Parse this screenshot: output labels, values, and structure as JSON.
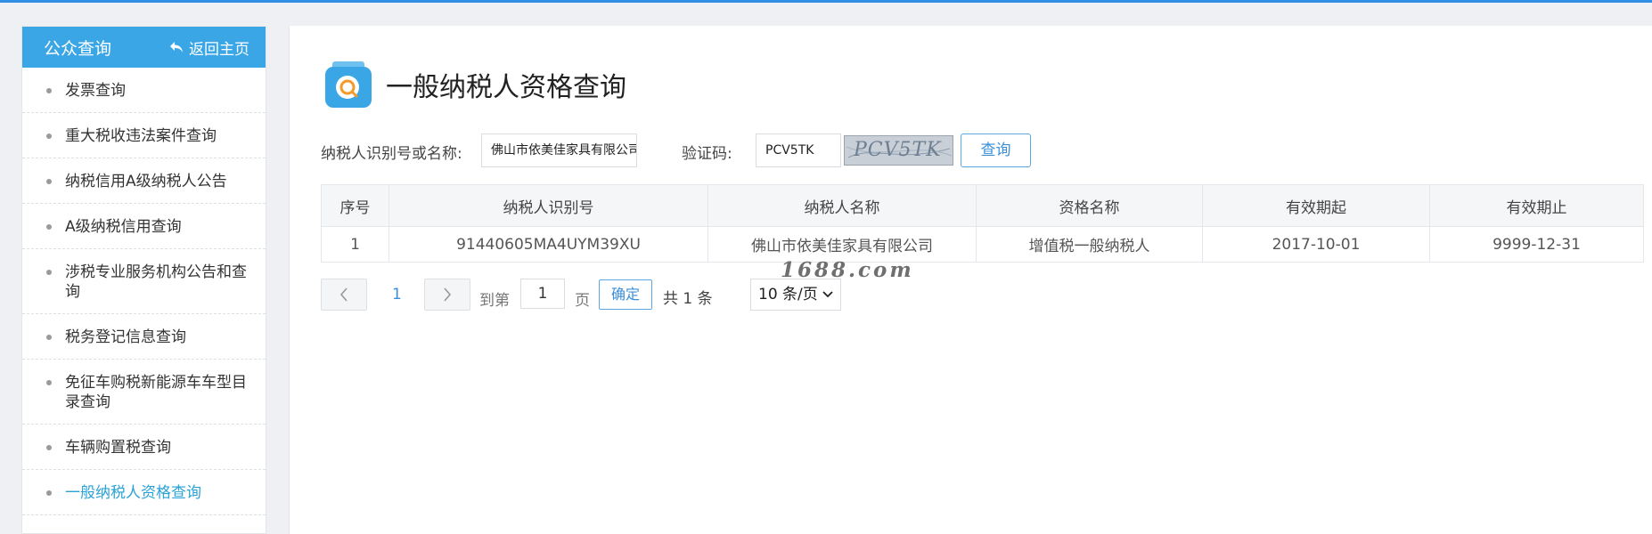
{
  "sidebar": {
    "title": "公众查询",
    "back_label": "返回主页",
    "items": [
      {
        "label": "发票查询"
      },
      {
        "label": "重大税收违法案件查询"
      },
      {
        "label": "纳税信用A级纳税人公告"
      },
      {
        "label": "A级纳税信用查询"
      },
      {
        "label": "涉税专业服务机构公告和查询"
      },
      {
        "label": "税务登记信息查询"
      },
      {
        "label": "免征车购税新能源车车型目录查询"
      },
      {
        "label": "车辆购置税查询"
      },
      {
        "label": "一般纳税人资格查询"
      }
    ]
  },
  "page": {
    "title": "一般纳税人资格查询"
  },
  "form": {
    "taxpayer_label": "纳税人识别号或名称:",
    "taxpayer_value": "佛山市依美佳家具有限公司",
    "captcha_label": "验证码:",
    "captcha_value": "PCV5TK",
    "captcha_image_text": "PCV5TK",
    "query_button": "查询"
  },
  "table": {
    "headers": [
      "序号",
      "纳税人识别号",
      "纳税人名称",
      "资格名称",
      "有效期起",
      "有效期止"
    ],
    "rows": [
      [
        "1",
        "91440605MA4UYM39XU",
        "佛山市依美佳家具有限公司",
        "增值税一般纳税人",
        "2017-10-01",
        "9999-12-31"
      ]
    ]
  },
  "pagination": {
    "current_page": "1",
    "goto_prefix": "到第",
    "goto_value": "1",
    "goto_suffix": "页",
    "confirm_label": "确定",
    "total_label": "共 1 条",
    "page_size": "10 条/页"
  },
  "watermark": "1688.com",
  "colors": {
    "accent": "#3aa6e6",
    "link": "#3b8fd8",
    "active_item": "#2aa2d6",
    "top_bar": "#2f8de4"
  }
}
